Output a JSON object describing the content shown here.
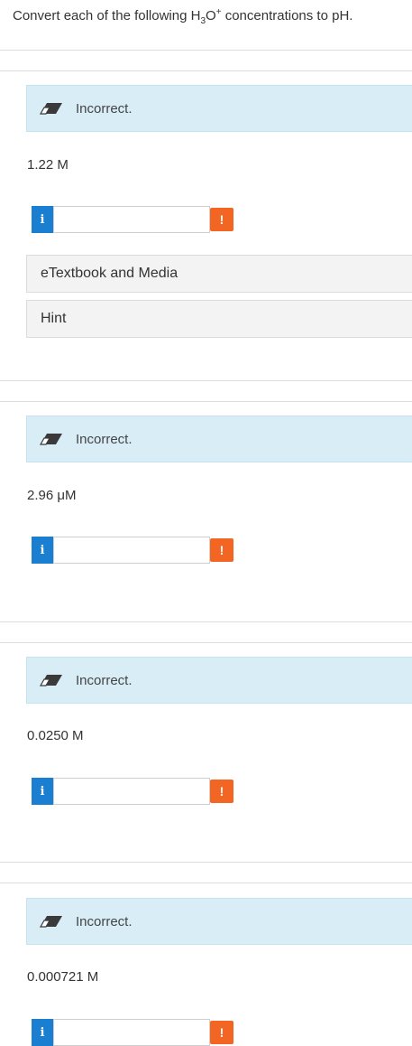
{
  "question": {
    "prefix": "Convert each of the following H",
    "sub": "3",
    "mid": "O",
    "sup": "+",
    "suffix": " concentrations to pH."
  },
  "parts": [
    {
      "status": "Incorrect.",
      "concentration": "1.22 M",
      "answer_value": ""
    },
    {
      "status": "Incorrect.",
      "concentration": "2.96 μM",
      "answer_value": ""
    },
    {
      "status": "Incorrect.",
      "concentration": "0.0250 M",
      "answer_value": ""
    },
    {
      "status": "Incorrect.",
      "concentration": "0.000721 M",
      "answer_value": ""
    }
  ],
  "icons": {
    "info_glyph": "i",
    "warning_glyph": "!"
  },
  "links": {
    "etextbook": "eTextbook and Media",
    "hint": "Hint"
  },
  "colors": {
    "incorrect_bg": "#d9edf7",
    "info_button": "#1b7fd1",
    "warning_button": "#f26522"
  }
}
